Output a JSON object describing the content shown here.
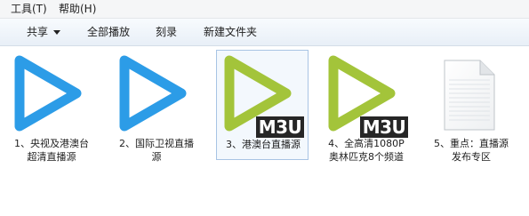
{
  "menu": {
    "items": [
      {
        "label": "工具(T)"
      },
      {
        "label": "帮助(H)"
      }
    ]
  },
  "toolbar": {
    "share_label": "共享",
    "play_all_label": "全部播放",
    "burn_label": "刻录",
    "new_folder_label": "新建文件夹"
  },
  "badge_text": "M3U",
  "colors": {
    "play_blue": "#2c9ce7",
    "play_green": "#a3c43a",
    "badge_bg": "#262626"
  },
  "files": [
    {
      "line1": "1、央视及港澳台",
      "line2": "超清直播源",
      "icon": "play-icon-blue"
    },
    {
      "line1": "2、国际卫视直播",
      "line2": "源",
      "icon": "play-icon-blue"
    },
    {
      "line1": "3、港澳台直播源",
      "line2": "",
      "icon": "play-icon-green-m3u"
    },
    {
      "line1": "4、全高清1080P",
      "line2": "奥林匹克8个频道",
      "icon": "play-icon-green-m3u"
    },
    {
      "line1": "5、重点：直播源",
      "line2": "发布专区",
      "icon": "document-icon"
    }
  ]
}
